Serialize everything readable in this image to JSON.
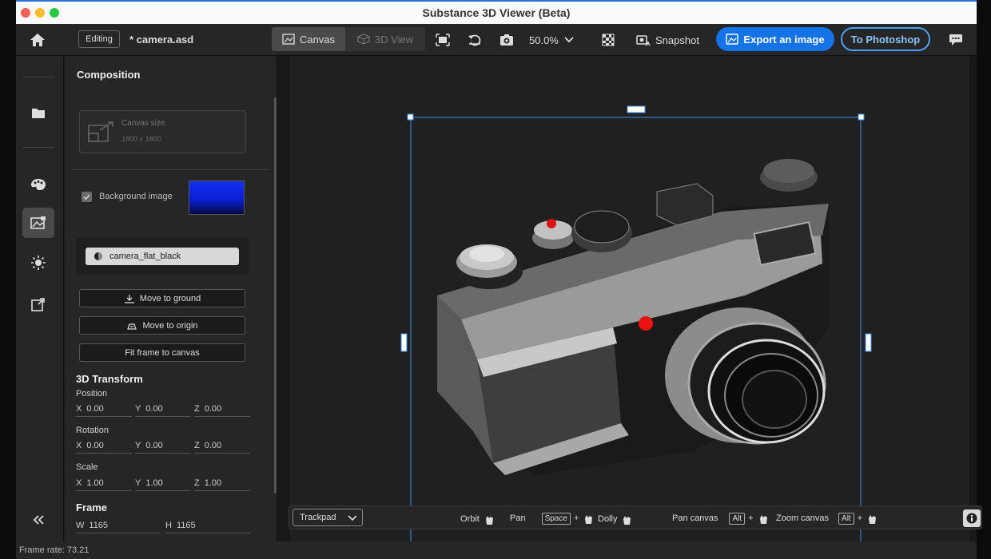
{
  "app": {
    "title": "Substance 3D Viewer (Beta)"
  },
  "toolbar": {
    "mode_label": "Editing",
    "file_name": "* camera.asd",
    "canvas_tab": "Canvas",
    "view3d_tab": "3D View",
    "zoom": "50.0%",
    "snapshot": "Snapshot",
    "export": "Export an image",
    "photoshop": "To Photoshop"
  },
  "panel": {
    "composition_title": "Composition",
    "canvas_size_label": "Canvas size",
    "canvas_size_value": "1800 x 1800",
    "background_label": "Background image",
    "material": "camera_flat_black",
    "move_ground": "Move to ground",
    "move_origin": "Move to origin",
    "fit_frame": "Fit frame to canvas",
    "transform_title": "3D Transform",
    "position_label": "Position",
    "rotation_label": "Rotation",
    "scale_label": "Scale",
    "axis_x": "X",
    "axis_y": "Y",
    "axis_z": "Z",
    "position": {
      "x": "0.00",
      "y": "0.00",
      "z": "0.00"
    },
    "rotation": {
      "x": "0.00",
      "y": "0.00",
      "z": "0.00"
    },
    "scale": {
      "x": "1.00",
      "y": "1.00",
      "z": "1.00"
    },
    "frame_title": "Frame",
    "frame_w_label": "W",
    "frame_h_label": "H",
    "frame_w": "1165",
    "frame_h": "1165"
  },
  "bottombar": {
    "input_mode": "Trackpad",
    "orbit": "Orbit",
    "pan": "Pan",
    "space_key": "Space",
    "plus": "+",
    "dolly": "Dolly",
    "pan_canvas": "Pan canvas",
    "alt_key": "Alt",
    "zoom_canvas": "Zoom canvas"
  },
  "status": {
    "frame_rate": "Frame rate: 73.21"
  },
  "colors": {
    "accent": "#1473e6",
    "background_image": "#0a1fd6"
  }
}
